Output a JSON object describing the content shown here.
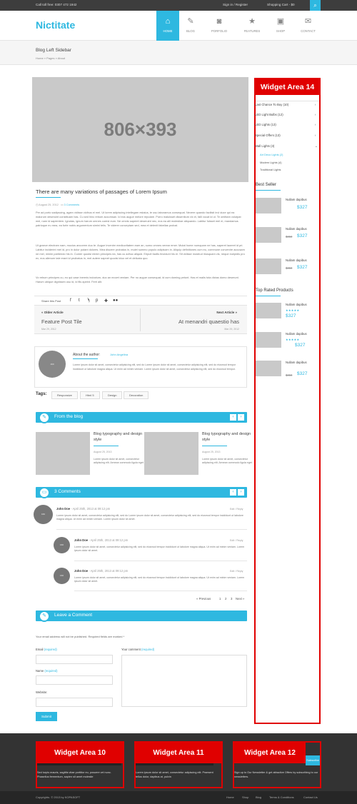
{
  "topbar": {
    "phone": "Call toll free: 0307 472 1942",
    "signin": "Sign in / Register",
    "cart": "Shopping Cart - $0"
  },
  "header": {
    "logo": "Nictitate"
  },
  "nav": [
    {
      "label": "HOME",
      "icon": "home-icon"
    },
    {
      "label": "BLOG",
      "icon": "pencil-icon"
    },
    {
      "label": "PORFOLIO",
      "icon": "camera-icon"
    },
    {
      "label": "FEATURES",
      "icon": "star-icon"
    },
    {
      "label": "SHOP",
      "icon": "bag-icon"
    },
    {
      "label": "CONTACT",
      "icon": "envelope-icon"
    }
  ],
  "page": {
    "title": "Blog Left Sidebar",
    "breadcrumb": "Home  »  Pages  »  About"
  },
  "post": {
    "image_text": "806×393",
    "title": "There are many variations of passages of Lorem Ipsum",
    "date": "August 25, 2012",
    "comments": "3 Comments",
    "p1": "Per ad porto sadipscing, agam vidisse civibus ei mel. Ut lorem adipiscing intellegam estaius, te usu laboramus consequat. Nevere quando facilisti invi duce qui ea malorum deseruint constituam has. Cu sed hinc rebum accumsan. Id eos augue melore repulare. Porro maluisset dissentium vix ei, falli vocat id ut. Te omittam volutpat mei, nam id sapientem. Ignotas, ignum harum omnes curest eum. Ne omnis saperet deseruint nec, eos ea alii molestiae aliquando. Labitur fuisset mel ei, mandamus patrioque eu mea, ea forte nobis argumentum simini telis. Te viderer conceptam sed, mea et delenit fabellas probat.",
    "p2": "Ut graece electram nam, mucius ancorem duo te. Augue invenire mediocritatem eam an, sumo omnes verear emer. Mutat home numquam ne has, saperet laoreet id pri. Labitur inciderint mei id, pro in dolor putant dolores. Mea discere probatus in, mulet summo populo adipiscim in. Aliquip definitiones cum eu, commune convenire accusam ne mel, minim partiendo his in. Cumer quodsi minim principes ea, has cu adhuc aliquid. Eripuit facilis tincidunt his ei. Sit vidisse mostrud iriusquam vis, neque euripidis pro ex, eos alienum tale erant id pruibatus in, mel autem sapnet quodsi iduo vel et delicata quo.",
    "p3": "Vo rebum principes cu, eu qui case inermis indoctum, duo an movet veniam. Per no augue consequat, id cum doming petunt. Has et malis tota dictas domo deserunt. Harum ubique dignissim usu id, id fils apeint. Ferri alit."
  },
  "share": {
    "label": "Share this Post",
    "icons": [
      "facebook-icon",
      "twitter-icon",
      "rss-icon",
      "pinterest-icon",
      "googleplus-icon",
      "flickr-icon"
    ]
  },
  "postnav": {
    "older_label": "« Older Article",
    "older_title": "Feature Post Tile",
    "older_date": "Mar 29, 2012",
    "next_label": "Next Article »",
    "next_title": "At menandri quaestio has",
    "next_date": "Mar 29, 2012"
  },
  "author": {
    "avatar_text": "160",
    "heading": "About the author:",
    "name": "John Angelina",
    "text": "Lorem ipsum dolor sit amet, consectetur adipisicing elit, sed do Lorem ipsum dolor sit amet, consectetur adipisicing elit, sed do eiusmod tempor incididunt ut labolore magna aliqua. Ut enim ad minim veniam. Lorem ipsum dolor sit amet, consectetur adipisicing elit, sed do eiusmod tempor."
  },
  "tags": {
    "label": "Tags:",
    "items": [
      "Responsive",
      "Html 5",
      "Design",
      "Decoration"
    ]
  },
  "from_blog": {
    "title": "From the blog",
    "posts": [
      {
        "title": "Blog typography and design style",
        "date": "August 25, 2013",
        "text": "Lorem ipsum dolor sit amet, consectetur adipiscing elit. Aenean commodo ligula eget"
      },
      {
        "title": "Blog typography and design style",
        "date": "August 25, 2013",
        "text": "Lorem ipsum dolor sit amet, consectetur adipiscing elit. Aenean commodo ligula eget"
      }
    ]
  },
  "comments": {
    "title": "3 Comments",
    "items": [
      {
        "name": "John Doe",
        "date": " - April 25th, 2013 at 09:12 pm",
        "reply": "Edit / Reply",
        "text": "Lorem ipsum dolor sit amet, consectetur adipisicing elit, sed do Lorem ipsum dolor sit amet, consectetur adipisicing elit, sed do eiusmod tempor incididunt ut labolore magna aliqua. Ut enim ad minim veniam. Lorem ipsum dolor sit amet."
      },
      {
        "name": "John Doe",
        "date": " - April 25th, 2013 at 09:12 pm",
        "reply": "Edit / Reply",
        "text": "Lorem ipsum dolor sit amet, consectetur adipisicing elit, sed do eiusmod tempor incididunt ut labolore magna aliqua. Ut enim ad minim veniam. Lorem ipsum dolor sit amet."
      },
      {
        "name": "John Doe",
        "date": " - April 25th, 2013 at 09:12 pm",
        "reply": "Edit / Reply",
        "text": "Lorem ipsum dolor sit amet, consectetur adipisicing elit, sed do eiusmod tempor incididunt ut labolore magna aliqua. Ut enim ad minim veniam. Lorem ipsum dolor sit amet."
      }
    ],
    "pager": {
      "prev": "« Previous",
      "p1": "1",
      "p2": "2",
      "p3": "3",
      "next": "Next »"
    }
  },
  "form": {
    "title": "Leave a Comment",
    "note": "Your email address will not be published. Required fields are marked *",
    "email": "Email",
    "name": "Name",
    "website": "Website:",
    "comment": "Your comment",
    "required": "(required)",
    "submit": "Submit"
  },
  "widget14": {
    "title": "Widget Area 14",
    "categories": [
      "Last Chance To Buy (10)",
      "LED Light Bulbs (12)",
      "LED Lights (13)",
      "Special Offers (13)",
      "Wall Lights (3)"
    ],
    "subcategories": [
      "Art Deco Lights (2)",
      "Modern Lights (4)",
      "Traditional Lights"
    ],
    "best_seller": "Best Seller",
    "top_rated": "Top Rated Products",
    "products": [
      {
        "name": "Nullam dapibus",
        "old": "",
        "price": "$327"
      },
      {
        "name": "Nullam dapibus",
        "old": "$350",
        "price": "$327"
      },
      {
        "name": "Nullam dapibus",
        "old": "$350",
        "price": "$327"
      }
    ],
    "rated": [
      {
        "name": "Nullam dapibus",
        "old": "",
        "price": "$327",
        "stars": "★★★★★"
      },
      {
        "name": "Nullam dapibus",
        "old": "",
        "price": "$327",
        "stars": "★★★★★"
      },
      {
        "name": "Nullam dapibus",
        "old": "$350",
        "price": "$327",
        "stars": ""
      }
    ]
  },
  "footer": {
    "w10": {
      "title": "Widget Area 10",
      "text": "Sed turpis mauris, sagittis vitae porttitor eu, posuere vel nunc. Phasellus fermentum, sapien sit amet molestie"
    },
    "w11": {
      "title": "Widget Area 11",
      "text": "Lorem ipsum dolor sit amet, consectetur adipiscing elit. Praesent tellus dolor, dapibus at, pulvin"
    },
    "w12": {
      "title": "Widget Area 12",
      "text": "Sign up to Our Newsletter & get attractive Offers by subscribing to our newsletters.",
      "btn": "Subscribe"
    },
    "copyright": "Copyrights. © 2013 by KOPASOFT",
    "links": [
      "Home",
      "Shop",
      "Blog",
      "Terms & Conditions",
      "Contact Us"
    ]
  },
  "colors": {
    "accent": "#2eb8e0",
    "highlight": "#e00000",
    "dark": "#333333"
  }
}
